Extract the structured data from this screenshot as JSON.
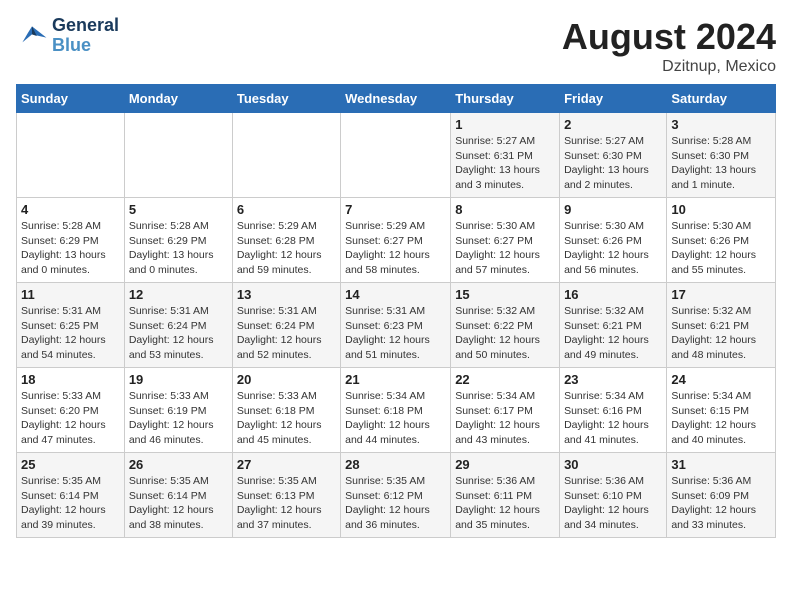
{
  "header": {
    "logo_line1": "General",
    "logo_line2": "Blue",
    "month_title": "August 2024",
    "location": "Dzitnup, Mexico"
  },
  "weekdays": [
    "Sunday",
    "Monday",
    "Tuesday",
    "Wednesday",
    "Thursday",
    "Friday",
    "Saturday"
  ],
  "weeks": [
    [
      {
        "day": "",
        "info": ""
      },
      {
        "day": "",
        "info": ""
      },
      {
        "day": "",
        "info": ""
      },
      {
        "day": "",
        "info": ""
      },
      {
        "day": "1",
        "info": "Sunrise: 5:27 AM\nSunset: 6:31 PM\nDaylight: 13 hours\nand 3 minutes."
      },
      {
        "day": "2",
        "info": "Sunrise: 5:27 AM\nSunset: 6:30 PM\nDaylight: 13 hours\nand 2 minutes."
      },
      {
        "day": "3",
        "info": "Sunrise: 5:28 AM\nSunset: 6:30 PM\nDaylight: 13 hours\nand 1 minute."
      }
    ],
    [
      {
        "day": "4",
        "info": "Sunrise: 5:28 AM\nSunset: 6:29 PM\nDaylight: 13 hours\nand 0 minutes."
      },
      {
        "day": "5",
        "info": "Sunrise: 5:28 AM\nSunset: 6:29 PM\nDaylight: 13 hours\nand 0 minutes."
      },
      {
        "day": "6",
        "info": "Sunrise: 5:29 AM\nSunset: 6:28 PM\nDaylight: 12 hours\nand 59 minutes."
      },
      {
        "day": "7",
        "info": "Sunrise: 5:29 AM\nSunset: 6:27 PM\nDaylight: 12 hours\nand 58 minutes."
      },
      {
        "day": "8",
        "info": "Sunrise: 5:30 AM\nSunset: 6:27 PM\nDaylight: 12 hours\nand 57 minutes."
      },
      {
        "day": "9",
        "info": "Sunrise: 5:30 AM\nSunset: 6:26 PM\nDaylight: 12 hours\nand 56 minutes."
      },
      {
        "day": "10",
        "info": "Sunrise: 5:30 AM\nSunset: 6:26 PM\nDaylight: 12 hours\nand 55 minutes."
      }
    ],
    [
      {
        "day": "11",
        "info": "Sunrise: 5:31 AM\nSunset: 6:25 PM\nDaylight: 12 hours\nand 54 minutes."
      },
      {
        "day": "12",
        "info": "Sunrise: 5:31 AM\nSunset: 6:24 PM\nDaylight: 12 hours\nand 53 minutes."
      },
      {
        "day": "13",
        "info": "Sunrise: 5:31 AM\nSunset: 6:24 PM\nDaylight: 12 hours\nand 52 minutes."
      },
      {
        "day": "14",
        "info": "Sunrise: 5:31 AM\nSunset: 6:23 PM\nDaylight: 12 hours\nand 51 minutes."
      },
      {
        "day": "15",
        "info": "Sunrise: 5:32 AM\nSunset: 6:22 PM\nDaylight: 12 hours\nand 50 minutes."
      },
      {
        "day": "16",
        "info": "Sunrise: 5:32 AM\nSunset: 6:21 PM\nDaylight: 12 hours\nand 49 minutes."
      },
      {
        "day": "17",
        "info": "Sunrise: 5:32 AM\nSunset: 6:21 PM\nDaylight: 12 hours\nand 48 minutes."
      }
    ],
    [
      {
        "day": "18",
        "info": "Sunrise: 5:33 AM\nSunset: 6:20 PM\nDaylight: 12 hours\nand 47 minutes."
      },
      {
        "day": "19",
        "info": "Sunrise: 5:33 AM\nSunset: 6:19 PM\nDaylight: 12 hours\nand 46 minutes."
      },
      {
        "day": "20",
        "info": "Sunrise: 5:33 AM\nSunset: 6:18 PM\nDaylight: 12 hours\nand 45 minutes."
      },
      {
        "day": "21",
        "info": "Sunrise: 5:34 AM\nSunset: 6:18 PM\nDaylight: 12 hours\nand 44 minutes."
      },
      {
        "day": "22",
        "info": "Sunrise: 5:34 AM\nSunset: 6:17 PM\nDaylight: 12 hours\nand 43 minutes."
      },
      {
        "day": "23",
        "info": "Sunrise: 5:34 AM\nSunset: 6:16 PM\nDaylight: 12 hours\nand 41 minutes."
      },
      {
        "day": "24",
        "info": "Sunrise: 5:34 AM\nSunset: 6:15 PM\nDaylight: 12 hours\nand 40 minutes."
      }
    ],
    [
      {
        "day": "25",
        "info": "Sunrise: 5:35 AM\nSunset: 6:14 PM\nDaylight: 12 hours\nand 39 minutes."
      },
      {
        "day": "26",
        "info": "Sunrise: 5:35 AM\nSunset: 6:14 PM\nDaylight: 12 hours\nand 38 minutes."
      },
      {
        "day": "27",
        "info": "Sunrise: 5:35 AM\nSunset: 6:13 PM\nDaylight: 12 hours\nand 37 minutes."
      },
      {
        "day": "28",
        "info": "Sunrise: 5:35 AM\nSunset: 6:12 PM\nDaylight: 12 hours\nand 36 minutes."
      },
      {
        "day": "29",
        "info": "Sunrise: 5:36 AM\nSunset: 6:11 PM\nDaylight: 12 hours\nand 35 minutes."
      },
      {
        "day": "30",
        "info": "Sunrise: 5:36 AM\nSunset: 6:10 PM\nDaylight: 12 hours\nand 34 minutes."
      },
      {
        "day": "31",
        "info": "Sunrise: 5:36 AM\nSunset: 6:09 PM\nDaylight: 12 hours\nand 33 minutes."
      }
    ]
  ]
}
